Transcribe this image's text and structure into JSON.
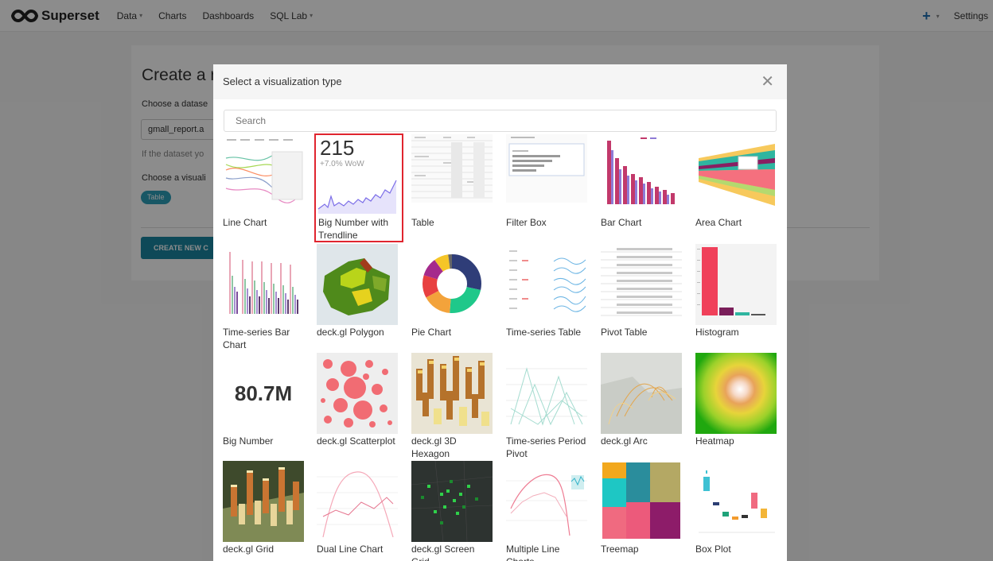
{
  "navbar": {
    "brand": "Superset",
    "items": [
      {
        "label": "Data",
        "caret": "▾"
      },
      {
        "label": "Charts"
      },
      {
        "label": "Dashboards"
      },
      {
        "label": "SQL Lab",
        "caret": "▾"
      }
    ],
    "plus_caret": "▾",
    "settings": "Settings"
  },
  "page": {
    "title": "Create a r",
    "choose_dataset": "Choose a datase",
    "dataset_value": "gmall_report.a",
    "hint": "If the dataset yo",
    "choose_viz": "Choose a visuali",
    "viz_tag": "Table",
    "create_button": "CREATE NEW C"
  },
  "modal": {
    "title": "Select a visualization type",
    "close_icon": "close-icon",
    "search_placeholder": "Search",
    "big_number_tile": {
      "value": "215",
      "delta": "+7.0% WoW"
    },
    "big_number_plain": "80.7M",
    "selected": "Big Number with Trendline",
    "tiles": [
      "Line Chart",
      "Big Number with Trendline",
      "Table",
      "Filter Box",
      "Bar Chart",
      "Area Chart",
      "Time-series Bar Chart",
      "deck.gl Polygon",
      "Pie Chart",
      "Time-series Table",
      "Pivot Table",
      "Histogram",
      "Big Number",
      "deck.gl Scatterplot",
      "deck.gl 3D Hexagon",
      "Time-series Period Pivot",
      "deck.gl Arc",
      "Heatmap",
      "deck.gl Grid",
      "Dual Line Chart",
      "deck.gl Screen Grid",
      "Multiple Line Charts",
      "Treemap",
      "Box Plot"
    ]
  },
  "colors": {
    "accent": "#1a85a0",
    "tag": "#2d9fb8",
    "selected_border": "#e0252f",
    "plus": "#1f6fb3"
  }
}
